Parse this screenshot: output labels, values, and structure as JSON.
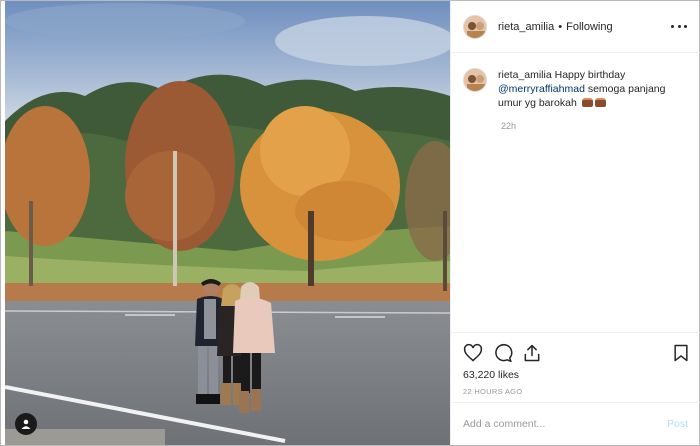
{
  "post": {
    "username": "rieta_amilia",
    "separator": "•",
    "follow_status": "Following",
    "caption": {
      "username": "rieta_amilia",
      "text_before": "Happy birthday",
      "mention": "@merryraffiahmad",
      "text_after": "semoga panjang umur yg barokah",
      "emoji": [
        "cake-emoji",
        "cake-emoji"
      ]
    },
    "caption_time": "22h",
    "likes": "63,220 likes",
    "timestamp": "22 HOURS AGO",
    "comment_placeholder": "Add a comment...",
    "post_button": "Post"
  },
  "icons": {
    "more": "more-options-icon",
    "like": "heart-icon",
    "comment": "comment-bubble-icon",
    "share": "share-icon",
    "save": "bookmark-icon",
    "user_tag": "user-tag-icon"
  },
  "colors": {
    "mention": "#003569",
    "secondary_text": "#999999",
    "post_button_disabled": "#b2dffc",
    "border": "#efefef"
  }
}
